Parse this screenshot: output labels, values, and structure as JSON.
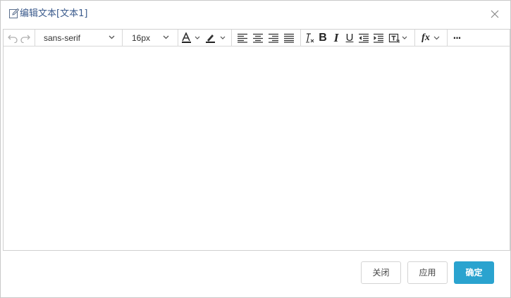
{
  "dialog": {
    "title": "编辑文本[文本1]",
    "title_icon": "edit-icon",
    "close_icon": "close-icon"
  },
  "toolbar": {
    "undo_icon": "undo-icon",
    "redo_icon": "redo-icon",
    "font_family": "sans-serif",
    "font_size": "16px",
    "icons": [
      "font-color-icon",
      "highlight-icon",
      "align-left-icon",
      "align-center-icon",
      "align-right-icon",
      "align-justify-icon",
      "clear-format-icon",
      "bold-icon",
      "italic-icon",
      "underline-icon",
      "outdent-icon",
      "indent-icon",
      "insert-textbox-icon",
      "formula-icon",
      "more-icon"
    ],
    "bold_glyph": "B",
    "italic_glyph": "I",
    "underline_glyph": "U",
    "formula_glyph": "fx",
    "more_glyph": "···"
  },
  "footer": {
    "close_label": "关闭",
    "apply_label": "应用",
    "confirm_label": "确定"
  },
  "colors": {
    "primary": "#2aa3cf",
    "title_text": "#3a5a8c",
    "border": "#c8c8c8"
  }
}
